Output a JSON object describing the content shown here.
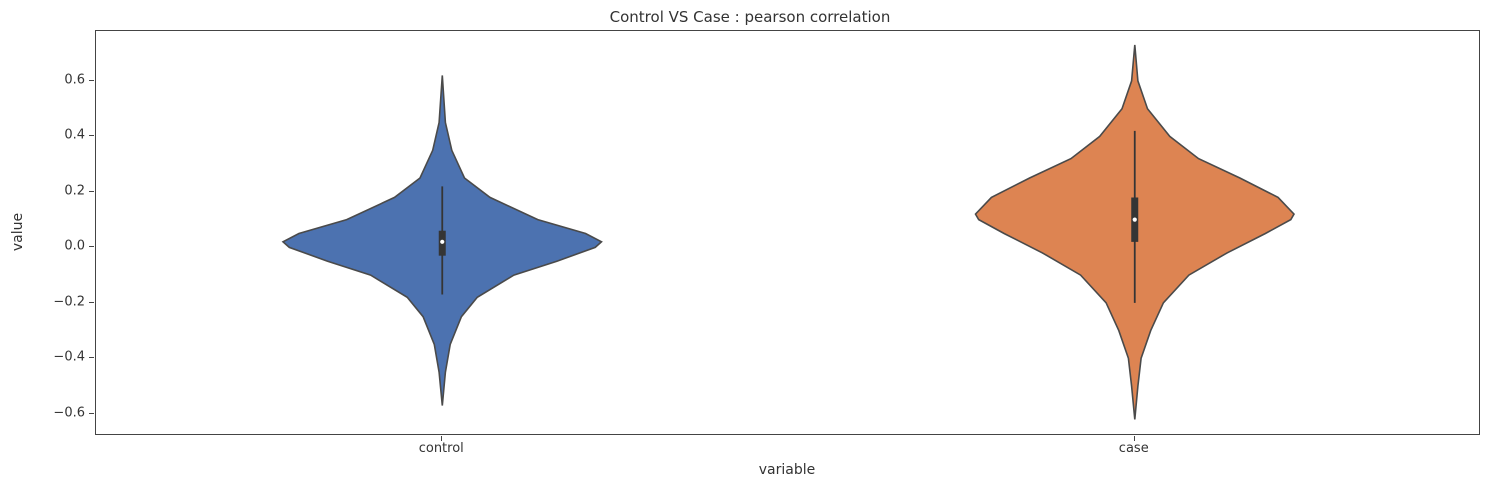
{
  "chart_data": {
    "type": "violin",
    "title": "Control VS Case : pearson correlation",
    "xlabel": "variable",
    "ylabel": "value",
    "categories": [
      "control",
      "case"
    ],
    "ylim": [
      -0.68,
      0.78
    ],
    "y_ticks": [
      -0.6,
      -0.4,
      -0.2,
      0.0,
      0.2,
      0.4,
      0.6
    ],
    "series": [
      {
        "name": "control",
        "color": "#4c72b0",
        "violin_range": [
          -0.57,
          0.62
        ],
        "kde_profile": [
          {
            "y": -0.57,
            "w": 0.0
          },
          {
            "y": -0.45,
            "w": 0.02
          },
          {
            "y": -0.35,
            "w": 0.05
          },
          {
            "y": -0.25,
            "w": 0.12
          },
          {
            "y": -0.18,
            "w": 0.22
          },
          {
            "y": -0.1,
            "w": 0.45
          },
          {
            "y": -0.05,
            "w": 0.72
          },
          {
            "y": 0.0,
            "w": 0.96
          },
          {
            "y": 0.02,
            "w": 1.0
          },
          {
            "y": 0.05,
            "w": 0.9
          },
          {
            "y": 0.1,
            "w": 0.6
          },
          {
            "y": 0.18,
            "w": 0.3
          },
          {
            "y": 0.25,
            "w": 0.14
          },
          {
            "y": 0.35,
            "w": 0.06
          },
          {
            "y": 0.45,
            "w": 0.02
          },
          {
            "y": 0.62,
            "w": 0.0
          }
        ],
        "box": {
          "q1": -0.03,
          "median": 0.02,
          "q3": 0.06,
          "whisker_lo": -0.17,
          "whisker_hi": 0.22
        }
      },
      {
        "name": "case",
        "color": "#dd8452",
        "violin_range": [
          -0.62,
          0.73
        ],
        "kde_profile": [
          {
            "y": -0.62,
            "w": 0.0
          },
          {
            "y": -0.5,
            "w": 0.02
          },
          {
            "y": -0.4,
            "w": 0.04
          },
          {
            "y": -0.3,
            "w": 0.1
          },
          {
            "y": -0.2,
            "w": 0.18
          },
          {
            "y": -0.1,
            "w": 0.34
          },
          {
            "y": -0.02,
            "w": 0.58
          },
          {
            "y": 0.05,
            "w": 0.82
          },
          {
            "y": 0.1,
            "w": 0.98
          },
          {
            "y": 0.12,
            "w": 1.0
          },
          {
            "y": 0.18,
            "w": 0.9
          },
          {
            "y": 0.25,
            "w": 0.66
          },
          {
            "y": 0.32,
            "w": 0.4
          },
          {
            "y": 0.4,
            "w": 0.22
          },
          {
            "y": 0.5,
            "w": 0.08
          },
          {
            "y": 0.6,
            "w": 0.02
          },
          {
            "y": 0.73,
            "w": 0.0
          }
        ],
        "box": {
          "q1": 0.02,
          "median": 0.1,
          "q3": 0.18,
          "whisker_lo": -0.2,
          "whisker_hi": 0.42
        }
      }
    ]
  }
}
